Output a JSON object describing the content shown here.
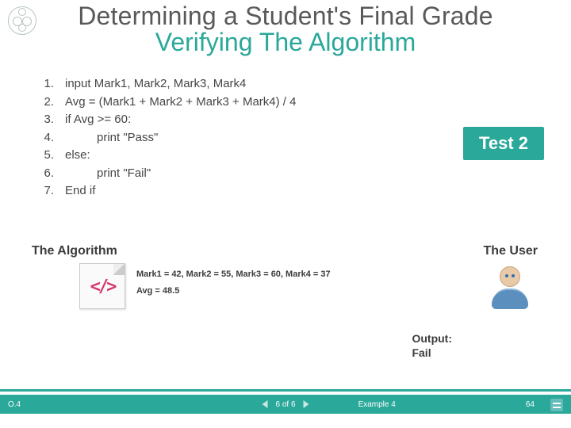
{
  "title": {
    "line1": "Determining a Student's Final Grade",
    "line2": "Verifying The Algorithm"
  },
  "algorithm": {
    "lines": [
      {
        "n": "1.",
        "text": "input Mark1, Mark2, Mark3, Mark4"
      },
      {
        "n": "2.",
        "text": "Avg = (Mark1 + Mark2 + Mark3 + Mark4) / 4"
      },
      {
        "n": "3.",
        "text": "if Avg >= 60:"
      },
      {
        "n": "4.",
        "text": "print \"Pass\"",
        "indent": true
      },
      {
        "n": "5.",
        "text": "else:"
      },
      {
        "n": "6.",
        "text": "print \"Fail\"",
        "indent": true
      },
      {
        "n": "7.",
        "text": "End if"
      }
    ]
  },
  "test_badge": "Test 2",
  "labels": {
    "algorithm": "The Algorithm",
    "user": "The User"
  },
  "trace": {
    "inputs": "Mark1 = 42, Mark2 = 55, Mark3 = 60, Mark4 = 37",
    "avg": "Avg = 48.5"
  },
  "output": {
    "label": "Output:",
    "value": "Fail"
  },
  "footer": {
    "version": "O.4",
    "progress": "6 of 6",
    "example": "Example 4",
    "slide": "64"
  },
  "icons": {
    "code": "</>"
  }
}
